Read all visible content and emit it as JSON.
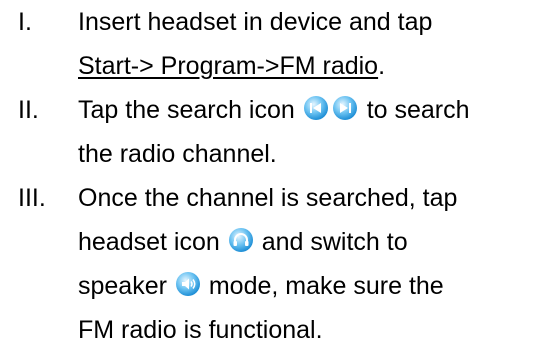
{
  "steps": [
    {
      "number": "I.",
      "line1": "Insert headset in device and tap",
      "link_text": "Start-> Program->FM radio",
      "link_tail": "."
    },
    {
      "number": "II.",
      "line1_before_icon": "Tap the search icon",
      "icon": "search-seek-icon",
      "line1_after_icon": "to search",
      "line2": "the radio channel."
    },
    {
      "number": "III.",
      "line1": "Once the channel is searched, tap",
      "line2_before_icon": "headset icon",
      "icon_headset": "headset-icon",
      "line2_after_icon": "and switch to",
      "line3_before_icon": "speaker",
      "icon_speaker": "speaker-icon",
      "line3_after_icon": "mode, make sure the",
      "line4": "FM radio is functional."
    }
  ],
  "colors": {
    "text": "#000000",
    "icon_blue": "#1f8fd6",
    "icon_light": "#bfe6fb"
  }
}
